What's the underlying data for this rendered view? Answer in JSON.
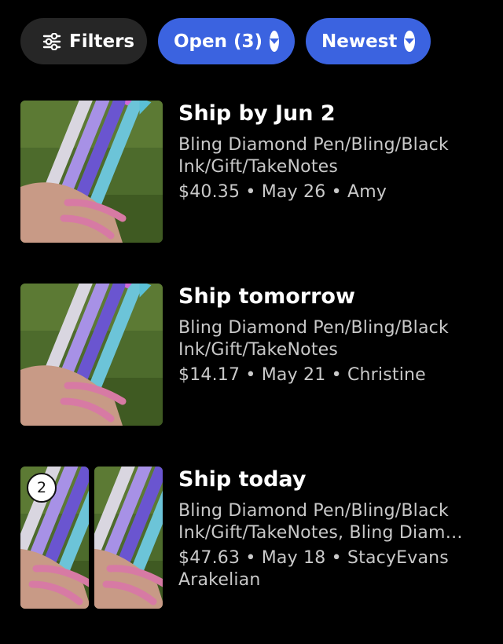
{
  "filters": {
    "filters_label": "Filters",
    "open_label": "Open (3)",
    "sort_label": "Newest",
    "accent_color": "#3b63e0"
  },
  "orders": [
    {
      "ship_status": "Ship by Jun 2",
      "title": "Bling Diamond Pen/Bling/Black Ink/Gift/TakeNotes",
      "meta": "$40.35 • May 26 • Amy"
    },
    {
      "ship_status": "Ship tomorrow",
      "title": "Bling Diamond Pen/Bling/Black Ink/Gift/TakeNotes",
      "meta": "$14.17 • May 21 • Christine"
    },
    {
      "ship_status": "Ship today",
      "title": "Bling Diamond Pen/Bling/Black Ink/Gift/TakeNotes, Bling Diam…",
      "meta": "$47.63 • May 18 • StacyEvans Arakelian",
      "item_count": "2"
    }
  ]
}
